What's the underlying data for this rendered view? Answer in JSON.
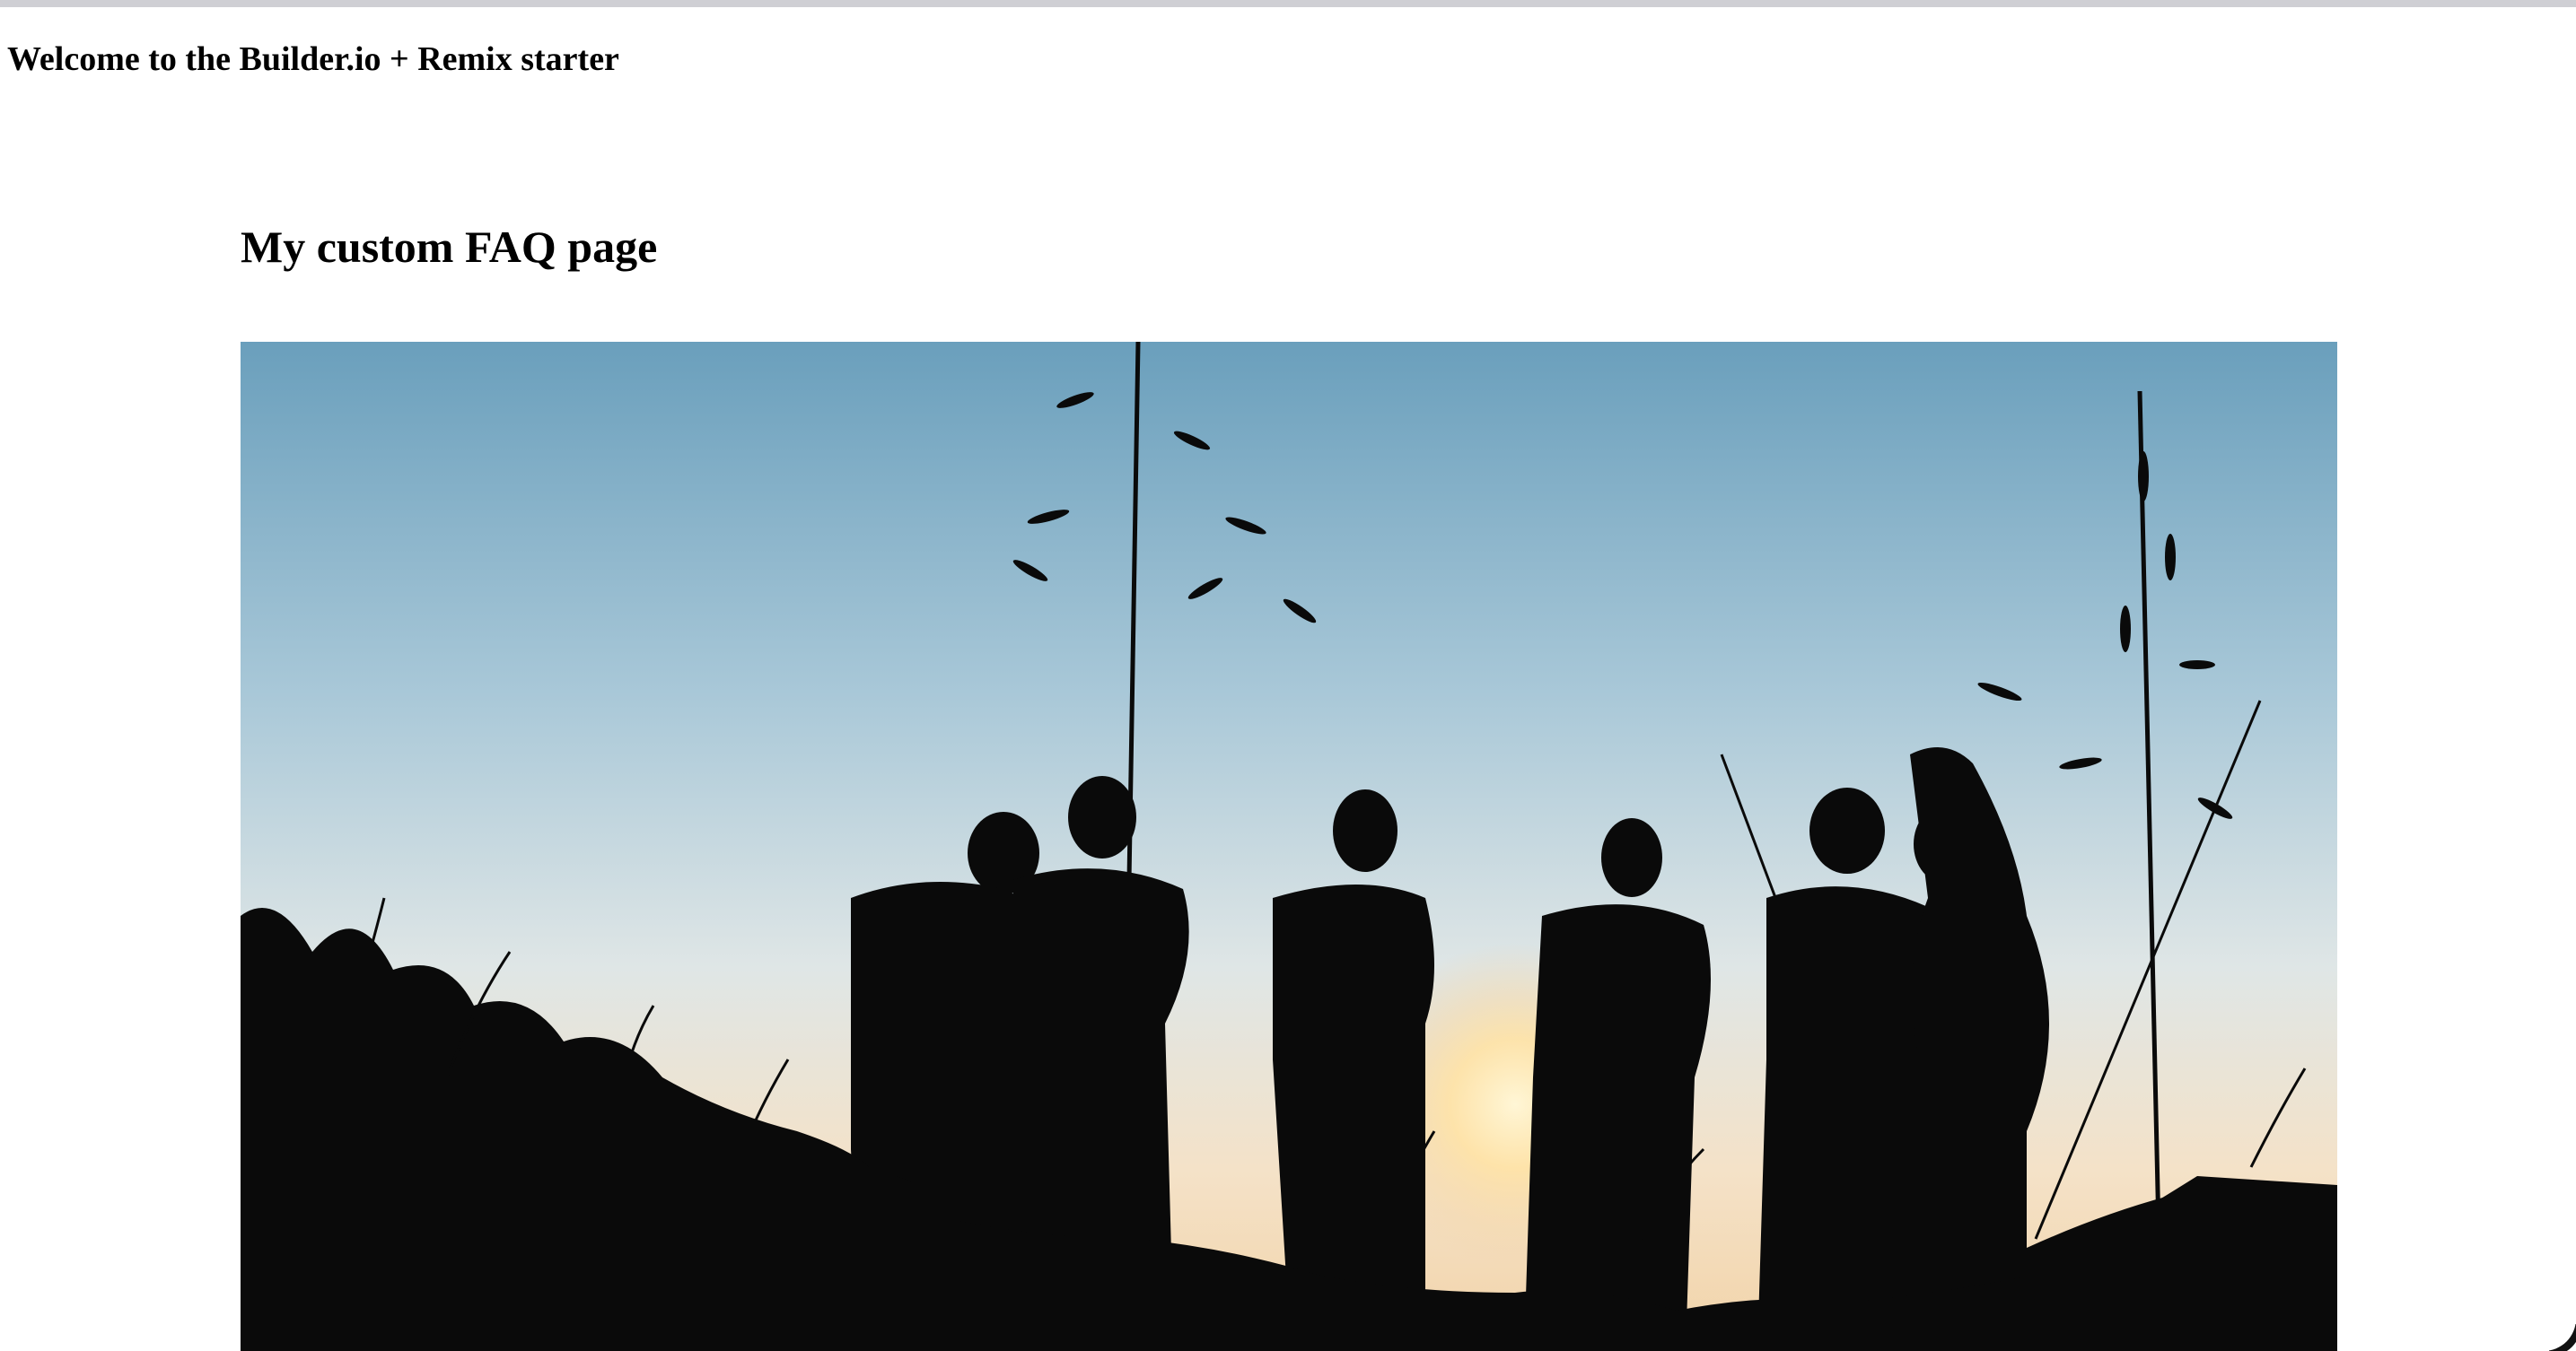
{
  "header": {
    "welcome_text": "Welcome to the Builder.io + Remix starter"
  },
  "main": {
    "page_title": "My custom FAQ page",
    "hero_image": {
      "description_icon": "silhouette-photo",
      "alt": "Group of friends silhouetted against a sunset sky"
    }
  },
  "colors": {
    "sky_top": "#6fa3bf",
    "sky_mid": "#c9dbe3",
    "sky_horizon": "#f3dcc0",
    "silhouette": "#0a0a0a",
    "sun": "#ffe9b8"
  }
}
